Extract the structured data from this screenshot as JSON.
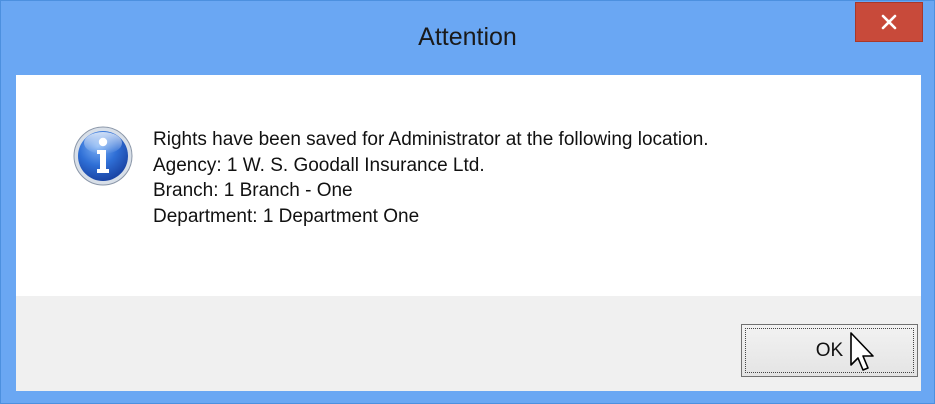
{
  "dialog": {
    "title": "Attention",
    "close_icon": "close-icon",
    "info_icon": "info-icon",
    "message_lines": [
      "Rights have been saved for Administrator at the following location.",
      "Agency: 1 W. S. Goodall Insurance Ltd.",
      "Branch: 1 Branch - One",
      "Department: 1 Department One"
    ],
    "ok_label": "OK"
  },
  "colors": {
    "titlebar": "#6aa7f3",
    "close_button": "#c84a3a",
    "footer": "#f0f0f0"
  }
}
